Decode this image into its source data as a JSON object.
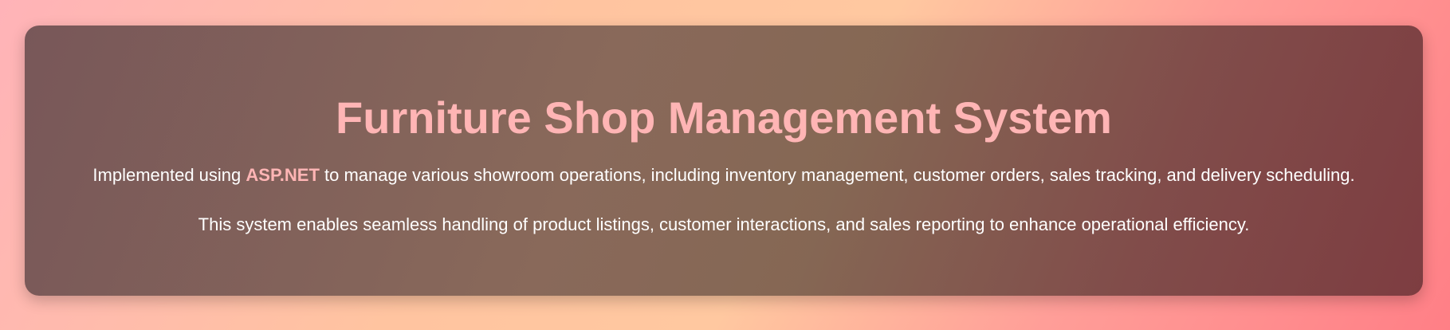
{
  "colors": {
    "accent": "#ffb5b5",
    "body_text": "#ffffff",
    "card_background": "#7d5f5a",
    "page_gradient_start": "#ffb3b8",
    "page_gradient_end": "#ff7f86"
  },
  "card": {
    "title": "Furniture Shop Management System",
    "intro_before": "Implemented using ",
    "intro_highlight": "ASP.NET",
    "intro_after": " to manage various showroom operations, including inventory management, customer orders, sales tracking, and delivery scheduling.",
    "paragraph_two": "This system enables seamless handling of product listings, customer interactions, and sales reporting to enhance operational efficiency."
  }
}
